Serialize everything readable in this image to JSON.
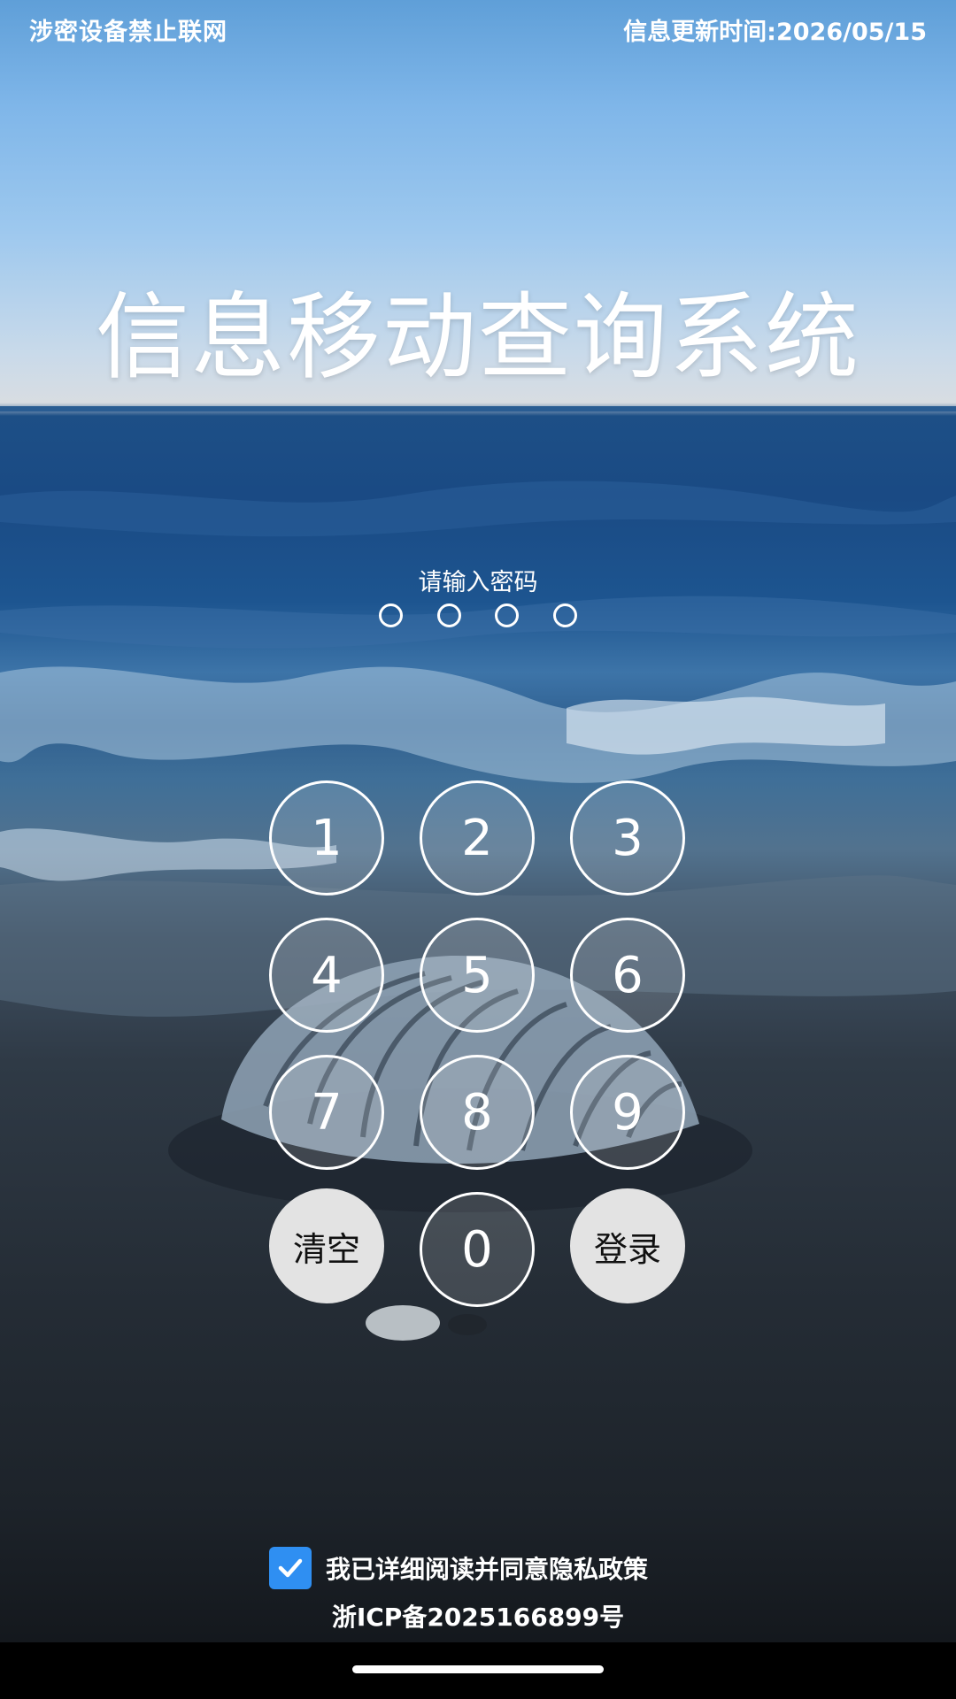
{
  "status": {
    "left_text": "涉密设备禁止联网",
    "right_text": "信息更新时间:2026/05/15"
  },
  "app": {
    "title": "信息移动查询系统"
  },
  "password": {
    "prompt": "请输入密码",
    "length": 4,
    "entered": 0
  },
  "keypad": {
    "keys": [
      "1",
      "2",
      "3",
      "4",
      "5",
      "6",
      "7",
      "8",
      "9"
    ],
    "clear_label": "清空",
    "zero_label": "0",
    "login_label": "登录"
  },
  "footer": {
    "agree_checked": true,
    "agree_text": "我已详细阅读并同意隐私政策",
    "icp": "浙ICP备2025166899号"
  },
  "colors": {
    "checkbox": "#2f8ff2",
    "action_key": "#e3e3e3"
  },
  "icons": {
    "checkbox": "checkmark-icon"
  }
}
